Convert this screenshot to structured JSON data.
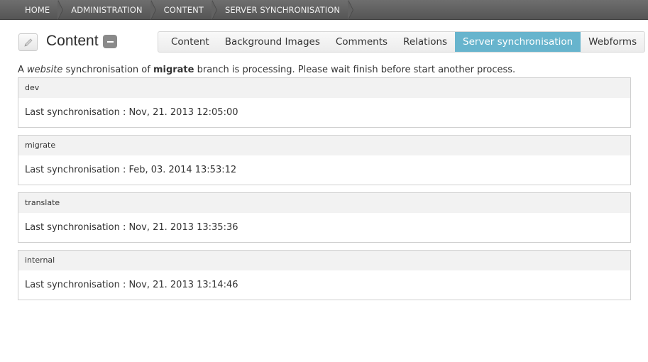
{
  "breadcrumb": [
    "HOME",
    "ADMINISTRATION",
    "CONTENT",
    "SERVER SYNCHRONISATION"
  ],
  "header": {
    "title": "Content",
    "edit_icon": "pencil-icon",
    "collapse_icon": "minus-icon"
  },
  "tabs": [
    {
      "label": "Content",
      "active": false
    },
    {
      "label": "Background Images",
      "active": false
    },
    {
      "label": "Comments",
      "active": false
    },
    {
      "label": "Relations",
      "active": false
    },
    {
      "label": "Server synchronisation",
      "active": true
    },
    {
      "label": "Webforms",
      "active": false
    }
  ],
  "message": {
    "prefix": "A ",
    "site": "website",
    "middle": " synchronisation of ",
    "branch": "migrate",
    "suffix": " branch is processing. Please wait finish before start another process."
  },
  "branches": [
    {
      "name": "dev",
      "label": "Last synchronisation : ",
      "date": "Nov, 21. 2013 12:05:00"
    },
    {
      "name": "migrate",
      "label": "Last synchronisation : ",
      "date": "Feb, 03. 2014 13:53:12"
    },
    {
      "name": "translate",
      "label": "Last synchronisation : ",
      "date": "Nov, 21. 2013 13:35:36"
    },
    {
      "name": "internal",
      "label": "Last synchronisation : ",
      "date": "Nov, 21. 2013 13:14:46"
    }
  ],
  "colors": {
    "active_tab": "#67b4cd",
    "breadcrumb_bg": "#5e5e5e"
  }
}
